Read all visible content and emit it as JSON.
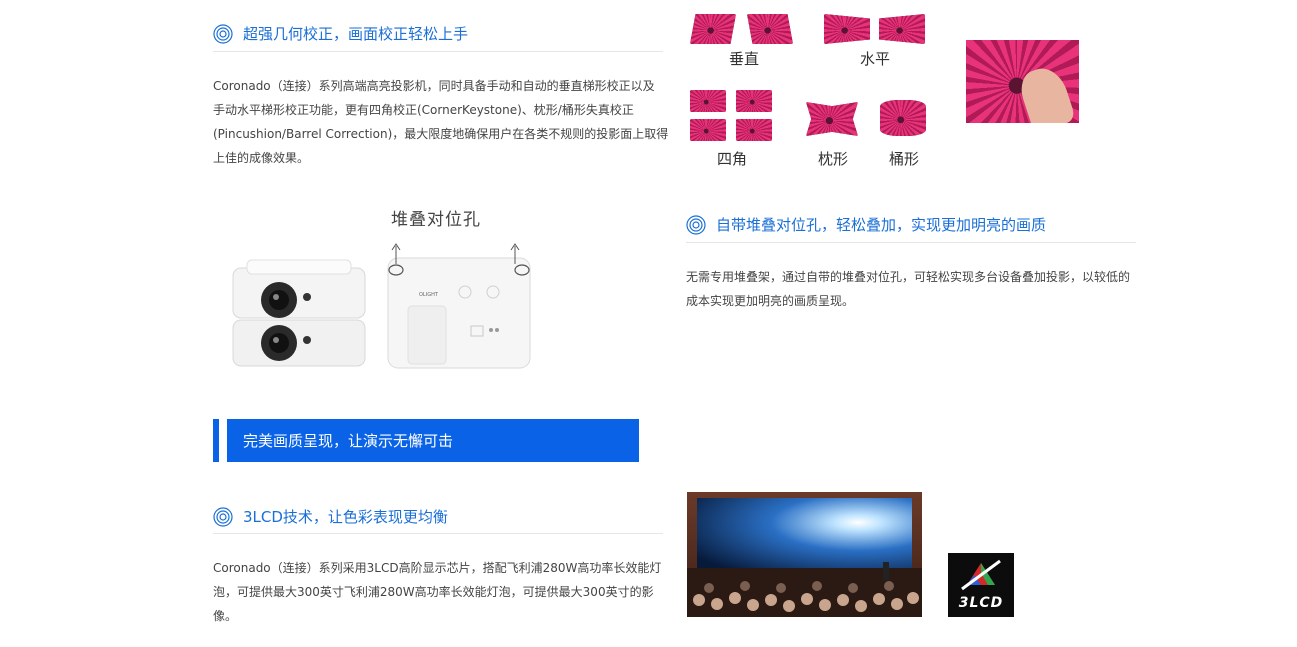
{
  "sections": {
    "keystone": {
      "title": "超强几何校正，画面校正轻松上手",
      "lines": [
        "Coronado（连接）系列高端高亮投影机，同时具备手动和自动的垂直梯形校正以及",
        "手动水平梯形校正功能，更有四角校正(CornerKeystone)、枕形/桶形失真校正",
        "(Pincushion/Barrel Correction)，最大限度地确保用户在各类不规则的投影面上取得",
        "上佳的成像效果。"
      ],
      "correction_labels": {
        "vertical": "垂直",
        "horizontal": "水平",
        "four_corner": "四角",
        "pincushion": "枕形",
        "barrel": "桶形"
      }
    },
    "stacking": {
      "image_caption": "堆叠对位孔",
      "title": "自带堆叠对位孔，轻松叠加，实现更加明亮的画质",
      "lines": [
        "无需专用堆叠架，通过自带的堆叠对位孔，可轻松实现多台设备叠加投影，以较低的",
        "成本实现更加明亮的画质呈现。"
      ],
      "brand_mark": "OLIGHT"
    },
    "banner": {
      "text": "完美画质呈现，让演示无懈可击"
    },
    "lcd": {
      "title": "3LCD技术，让色彩表现更均衡",
      "lines": [
        "Coronado（连接）系列采用3LCD高阶显示芯片，搭配飞利浦280W高功率长效能灯",
        "泡，可提供最大300英寸飞利浦280W高功率长效能灯泡，可提供最大300英寸的影",
        "像。"
      ],
      "logo_text": "3LCD"
    }
  },
  "colors": {
    "accent": "#1a6fd6",
    "banner_blue": "#0a63e6",
    "flower_pink": "#e8337b"
  }
}
